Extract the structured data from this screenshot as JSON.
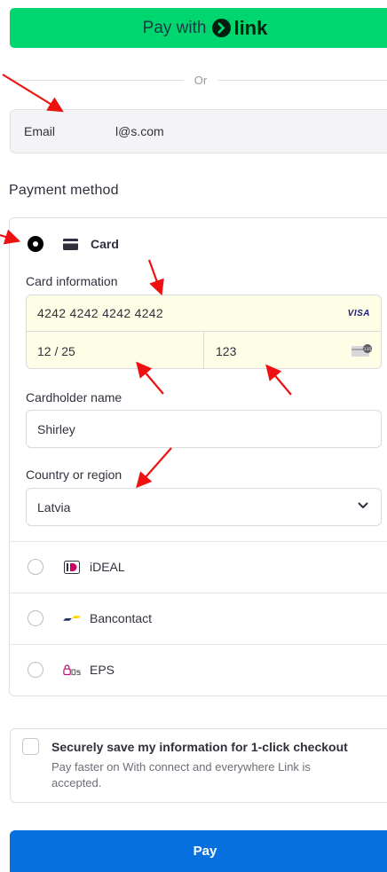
{
  "link_button": {
    "prefix": "Pay with",
    "brand": "link",
    "bg": "#00d66f"
  },
  "divider_text": "Or",
  "email": {
    "label": "Email",
    "value": "l@s.com"
  },
  "payment_section": {
    "title": "Payment method"
  },
  "card": {
    "label": "Card",
    "info_label": "Card information",
    "number": "4242 4242 4242 4242",
    "brand_logo": "VISA",
    "expiry": "12 / 25",
    "cvc": "123",
    "cvc_icon_text": "135"
  },
  "cardholder": {
    "label": "Cardholder name",
    "value": "Shirley"
  },
  "country": {
    "label": "Country or region",
    "value": "Latvia"
  },
  "methods": [
    {
      "label": "iDEAL",
      "icon": "ideal-icon"
    },
    {
      "label": "Bancontact",
      "icon": "bancontact-icon"
    },
    {
      "label": "EPS",
      "icon": "eps-icon"
    }
  ],
  "save_info": {
    "title": "Securely save my information for 1-click checkout",
    "description": "Pay faster on With connect and everywhere Link is accepted."
  },
  "pay_button": {
    "label": "Pay",
    "bg": "#0570de"
  },
  "annotation_color": "#ee1111"
}
